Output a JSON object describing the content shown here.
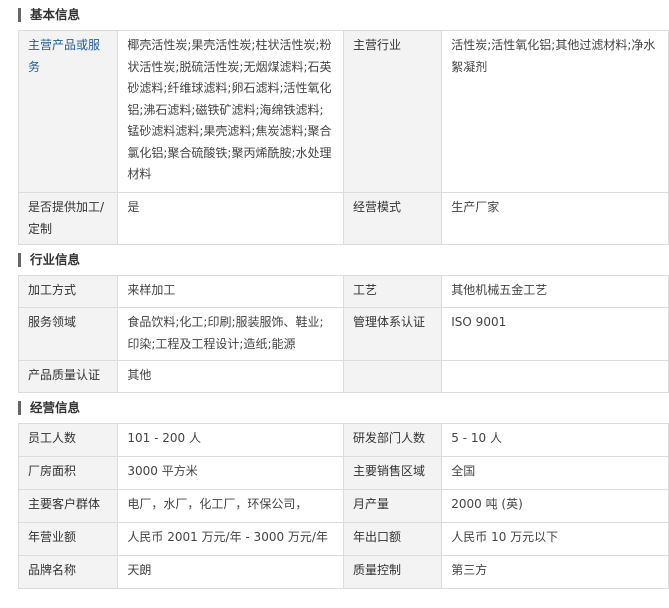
{
  "sections": [
    {
      "title": "基本信息",
      "rows": [
        {
          "l1": "主营产品或服务",
          "v1": "椰壳活性炭;果壳活性炭;柱状活性炭;粉状活性炭;脱硫活性炭;无烟煤滤料;石英砂滤料;纤维球滤料;卵石滤料;活性氧化铝;沸石滤料;磁铁矿滤料;海绵铁滤料;锰砂滤料滤料;果壳滤料;焦炭滤料;聚合氯化铝;聚合硫酸铁;聚丙烯酰胺;水处理材料",
          "l2": "主营行业",
          "v2": "活性炭;活性氧化铝;其他过滤材料;净水絮凝剂"
        },
        {
          "l1": "是否提供加工/定制",
          "v1": "是",
          "l2": "经营模式",
          "v2": "生产厂家"
        }
      ]
    },
    {
      "title": "行业信息",
      "rows": [
        {
          "l1": "加工方式",
          "v1": "来样加工",
          "l2": "工艺",
          "v2": "其他机械五金工艺"
        },
        {
          "l1": "服务领域",
          "v1": "食品饮料;化工;印刷;服装服饰、鞋业;印染;工程及工程设计;造纸;能源",
          "l2": "管理体系认证",
          "v2": "ISO 9001"
        },
        {
          "l1": "产品质量认证",
          "v1": "其他",
          "l2": "",
          "v2": ""
        }
      ]
    },
    {
      "title": "经营信息",
      "rows": [
        {
          "l1": "员工人数",
          "v1": "101 - 200 人",
          "l2": "研发部门人数",
          "v2": "5 - 10 人"
        },
        {
          "l1": "厂房面积",
          "v1": "3000 平方米",
          "l2": "主要销售区域",
          "v2": "全国"
        },
        {
          "l1": "主要客户群体",
          "v1": "电厂，水厂，化工厂，环保公司，",
          "l2": "月产量",
          "v2": "2000 吨 (英)"
        },
        {
          "l1": "年营业额",
          "v1": "人民币 2001 万元/年 - 3000 万元/年",
          "l2": "年出口额",
          "v2": "人民币 10 万元以下"
        },
        {
          "l1": "品牌名称",
          "v1": "天朗",
          "l2": "质量控制",
          "v2": "第三方"
        }
      ]
    }
  ]
}
